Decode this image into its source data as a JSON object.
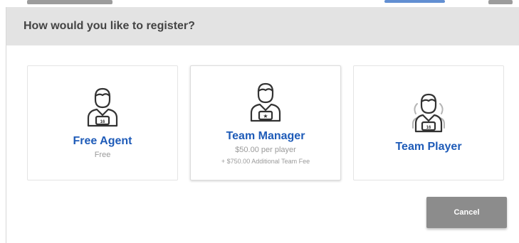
{
  "modal": {
    "title": "How would you like to register?"
  },
  "options": [
    {
      "title": "Free Agent",
      "subtitle": "Free",
      "icon": "free-agent-icon"
    },
    {
      "title": "Team Manager",
      "subtitle": "$50.00 per player",
      "note": "+ $750.00 Additional Team Fee",
      "icon": "team-manager-icon"
    },
    {
      "title": "Team Player",
      "icon": "team-player-icon"
    }
  ],
  "cancel_label": "Cancel",
  "colors": {
    "accent": "#1e5bb8",
    "header_bg": "#e3e3e3",
    "cancel_bg": "#8c8c8c"
  }
}
